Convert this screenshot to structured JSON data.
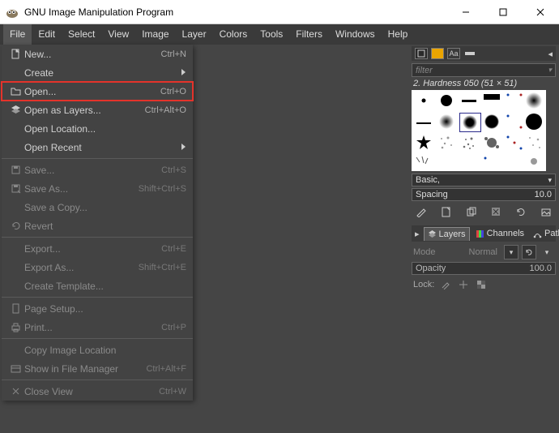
{
  "window": {
    "title": "GNU Image Manipulation Program"
  },
  "menubar": [
    "File",
    "Edit",
    "Select",
    "View",
    "Image",
    "Layer",
    "Colors",
    "Tools",
    "Filters",
    "Windows",
    "Help"
  ],
  "menubar_active_index": 0,
  "file_menu": [
    {
      "icon": "new-doc-icon",
      "label": "New...",
      "shortcut": "Ctrl+N"
    },
    {
      "label": "Create",
      "submenu": true
    },
    {
      "icon": "folder-icon",
      "label": "Open...",
      "shortcut": "Ctrl+O",
      "highlighted": true
    },
    {
      "icon": "layers-icon",
      "label": "Open as Layers...",
      "shortcut": "Ctrl+Alt+O"
    },
    {
      "label": "Open Location..."
    },
    {
      "label": "Open Recent",
      "submenu": true
    },
    {
      "sep": true
    },
    {
      "icon": "save-icon",
      "label": "Save...",
      "shortcut": "Ctrl+S",
      "disabled": true
    },
    {
      "icon": "saveas-icon",
      "label": "Save As...",
      "shortcut": "Shift+Ctrl+S",
      "disabled": true
    },
    {
      "label": "Save a Copy...",
      "disabled": true
    },
    {
      "icon": "revert-icon",
      "label": "Revert",
      "disabled": true
    },
    {
      "sep": true
    },
    {
      "label": "Export...",
      "shortcut": "Ctrl+E",
      "disabled": true
    },
    {
      "label": "Export As...",
      "shortcut": "Shift+Ctrl+E",
      "disabled": true
    },
    {
      "label": "Create Template...",
      "disabled": true
    },
    {
      "sep": true
    },
    {
      "icon": "page-icon",
      "label": "Page Setup...",
      "disabled": true
    },
    {
      "icon": "print-icon",
      "label": "Print...",
      "shortcut": "Ctrl+P",
      "disabled": true
    },
    {
      "sep": true
    },
    {
      "label": "Copy Image Location",
      "disabled": true
    },
    {
      "icon": "file-mgr-icon",
      "label": "Show in File Manager",
      "shortcut": "Ctrl+Alt+F",
      "disabled": true
    },
    {
      "sep": true
    },
    {
      "icon": "close-icon",
      "label": "Close View",
      "shortcut": "Ctrl+W",
      "disabled": true
    }
  ],
  "brushes": {
    "filter_placeholder": "filter",
    "current": "2. Hardness 050 (51 × 51)",
    "preset": "Basic,",
    "spacing_label": "Spacing",
    "spacing_value": "10.0"
  },
  "layers": {
    "tabs": [
      "Layers",
      "Channels",
      "Paths"
    ],
    "active": 0,
    "mode_label": "Mode",
    "mode_value": "Normal",
    "opacity_label": "Opacity",
    "opacity_value": "100.0",
    "lock_label": "Lock:"
  }
}
